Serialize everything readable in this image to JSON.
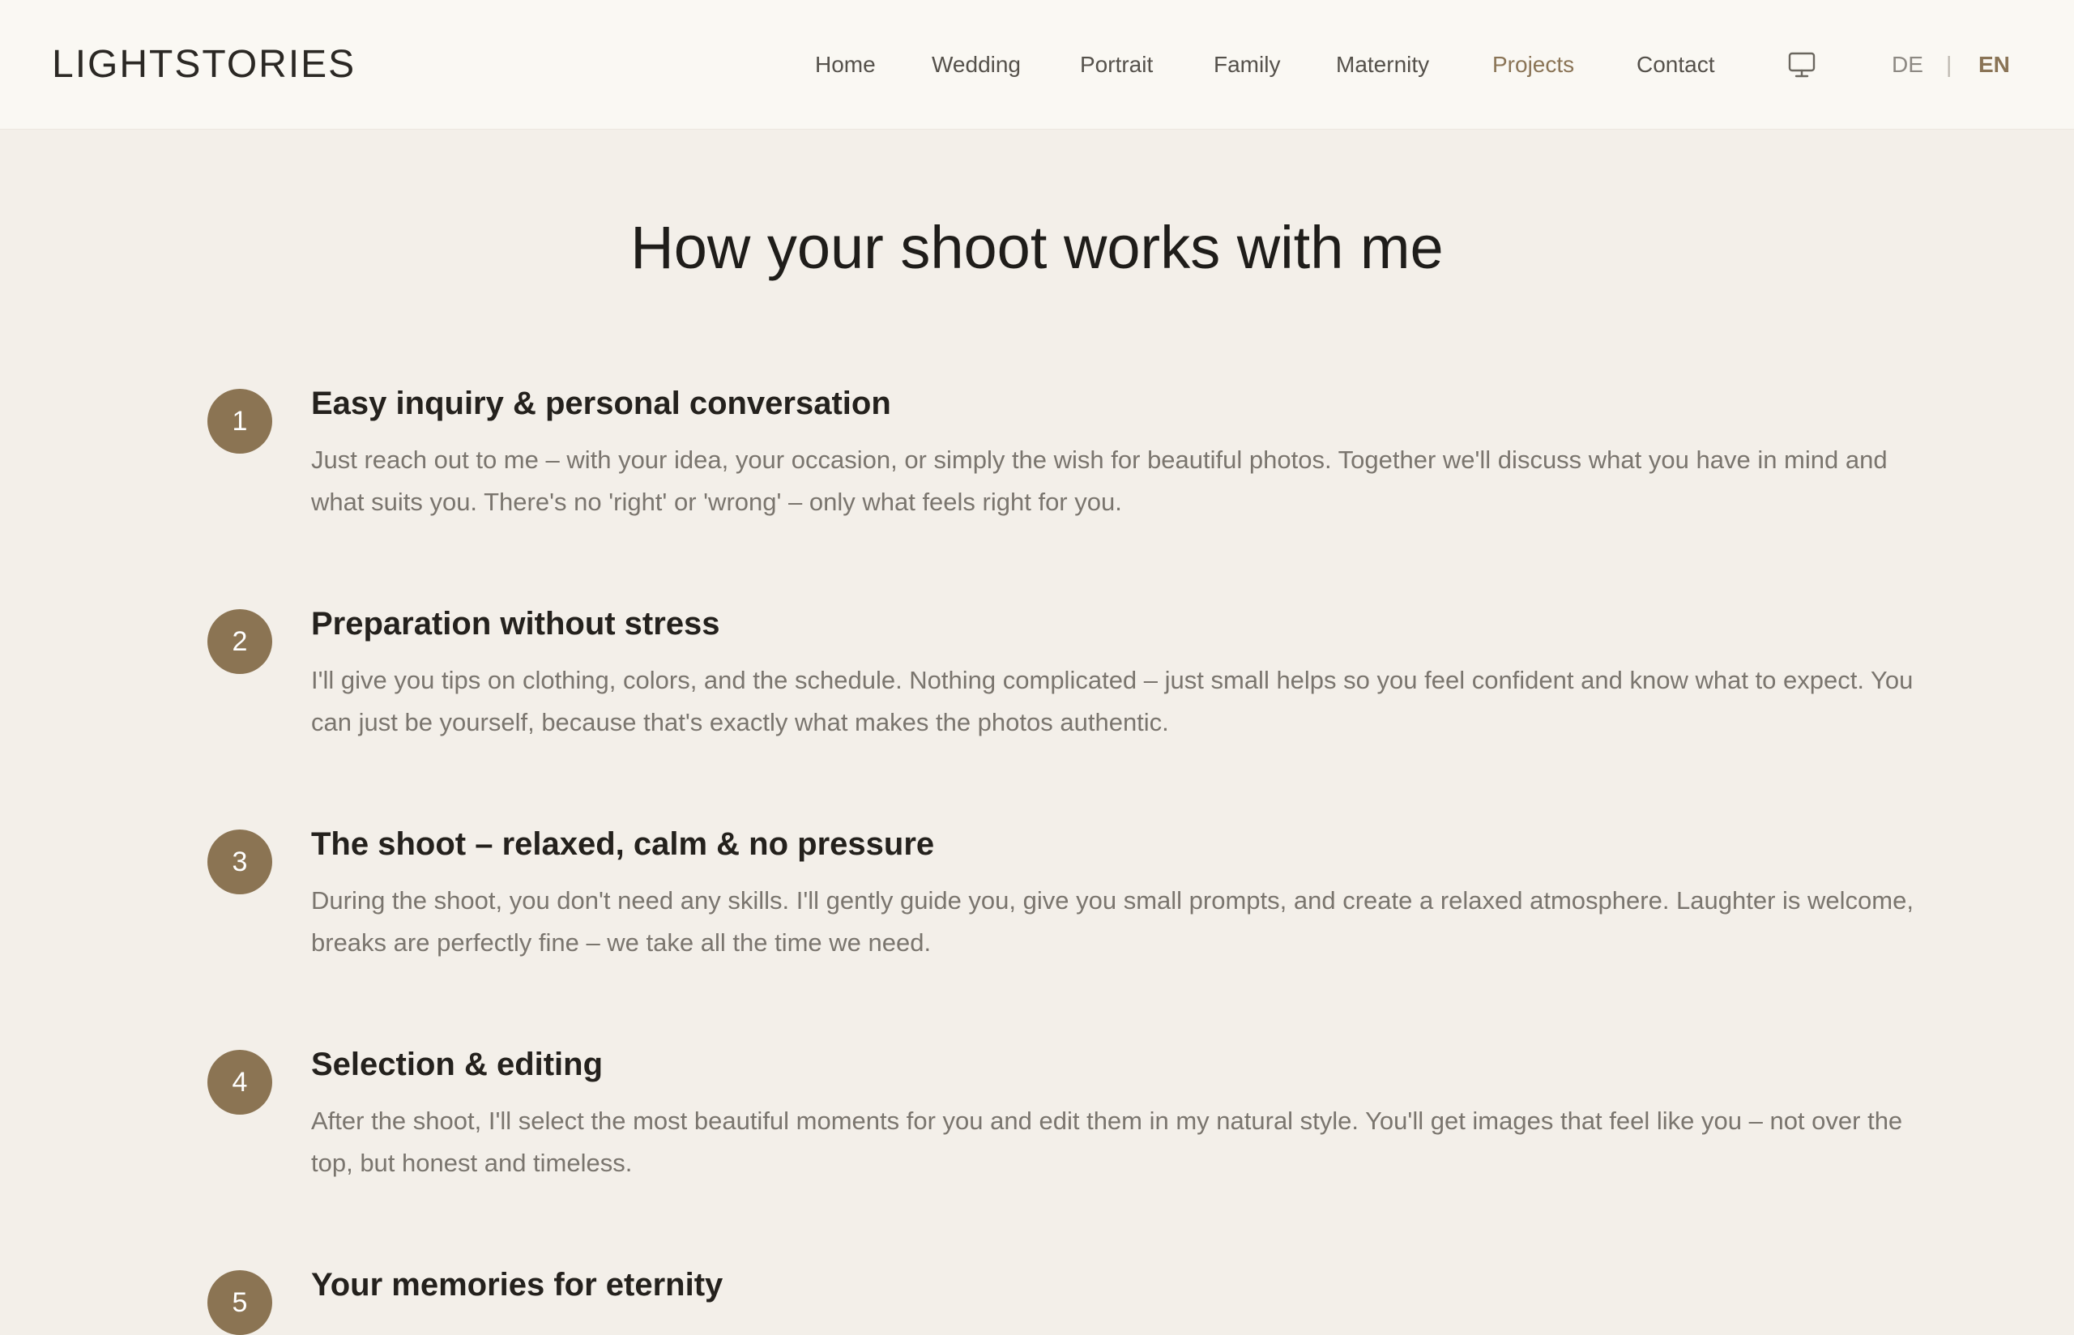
{
  "header": {
    "logo": "LIGHTSTORIES",
    "nav": [
      {
        "label": "Home",
        "active": false
      },
      {
        "label": "Wedding",
        "active": false
      },
      {
        "label": "Portrait",
        "active": false
      },
      {
        "label": "Family",
        "active": false
      },
      {
        "label": "Maternity",
        "active": false
      },
      {
        "label": "Projects",
        "active": true
      },
      {
        "label": "Contact",
        "active": false
      }
    ],
    "theme_icon": "monitor-icon",
    "languages": {
      "de": "DE",
      "separator": "|",
      "en": "EN",
      "selected": "EN"
    }
  },
  "main": {
    "title": "How your shoot works with me",
    "steps": [
      {
        "number": "1",
        "title": "Easy inquiry & personal conversation",
        "body": "Just reach out to me – with your idea, your occasion, or simply the wish for beautiful photos. Together we'll discuss what you have in mind and what suits you. There's no 'right' or 'wrong' – only what feels right for you."
      },
      {
        "number": "2",
        "title": "Preparation without stress",
        "body": "I'll give you tips on clothing, colors, and the schedule. Nothing complicated – just small helps so you feel confident and know what to expect. You can just be yourself, because that's exactly what makes the photos authentic."
      },
      {
        "number": "3",
        "title": "The shoot – relaxed, calm & no pressure",
        "body": "During the shoot, you don't need any skills. I'll gently guide you, give you small prompts, and create a relaxed atmosphere. Laughter is welcome, breaks are perfectly fine – we take all the time we need."
      },
      {
        "number": "4",
        "title": "Selection & editing",
        "body": "After the shoot, I'll select the most beautiful moments for you and edit them in my natural style. You'll get images that feel like you – not over the top, but honest and timeless."
      },
      {
        "number": "5",
        "title": "Your memories for eternity"
      }
    ]
  },
  "colors": {
    "accent": "#8b7453",
    "active_nav": "#8a7456",
    "page_background": "#f3efe9",
    "header_background": "#faf8f3"
  }
}
